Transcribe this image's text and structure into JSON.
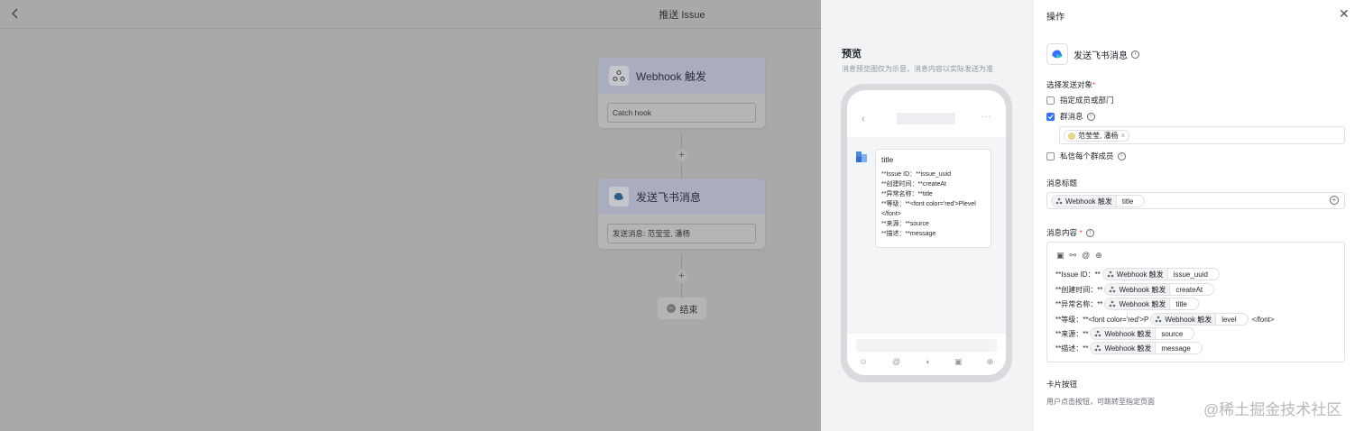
{
  "canvas": {
    "title": "推送 Issue",
    "nodes": [
      {
        "title": "Webhook 触发",
        "field": "Catch hook"
      },
      {
        "title": "发送飞书消息",
        "field": "发送消息: 范莹莹, 潘杨"
      }
    ],
    "plus": "+",
    "end_label": "结束"
  },
  "preview": {
    "title": "预览",
    "subtitle": "消息预览图仅为示意，消息内容以实际发送为准",
    "message_title": "title",
    "message_lines": [
      "**Issue ID：**issue_uuid",
      "**创建时间：**createAt",
      "**异常名称：**title",
      "**等级：**<font color='red'>Plevel",
      "</font>",
      "**来源：**source",
      "**描述：**message"
    ]
  },
  "action": {
    "title": "操作",
    "app_name": "发送飞书消息",
    "target_label": "选择发送对象",
    "required_mark": "*",
    "options": [
      {
        "label": "指定成员或部门",
        "checked": false
      },
      {
        "label": "群消息",
        "checked": true
      },
      {
        "label": "私信每个群成员",
        "checked": false
      }
    ],
    "selected_tag": "范莹莹, 潘杨",
    "msg_title_label": "消息标题",
    "source_name": "Webhook 触发",
    "msg_title_field": "title",
    "msg_content_label": "消息内容",
    "content_lines": [
      {
        "prefix": "**Issue ID：**",
        "field": "issue_uuid",
        "suffix": ""
      },
      {
        "prefix": "**创建时间：**",
        "field": "createAt",
        "suffix": ""
      },
      {
        "prefix": "**异常名称：**",
        "field": "title",
        "suffix": ""
      },
      {
        "prefix": "**等级：**<font color='red'>P",
        "field": "level",
        "suffix": "</font>"
      },
      {
        "prefix": "**来源：**",
        "field": "source",
        "suffix": ""
      },
      {
        "prefix": "**描述：**",
        "field": "message",
        "suffix": ""
      }
    ],
    "card_button_label": "卡片按钮",
    "card_button_desc": "用户点击按钮，可跳转至指定页面"
  },
  "watermark": "@稀土掘金技术社区",
  "colors": {
    "accent": "#3370ff",
    "required": "#f54a45",
    "overlay": "#a9a9a9"
  }
}
